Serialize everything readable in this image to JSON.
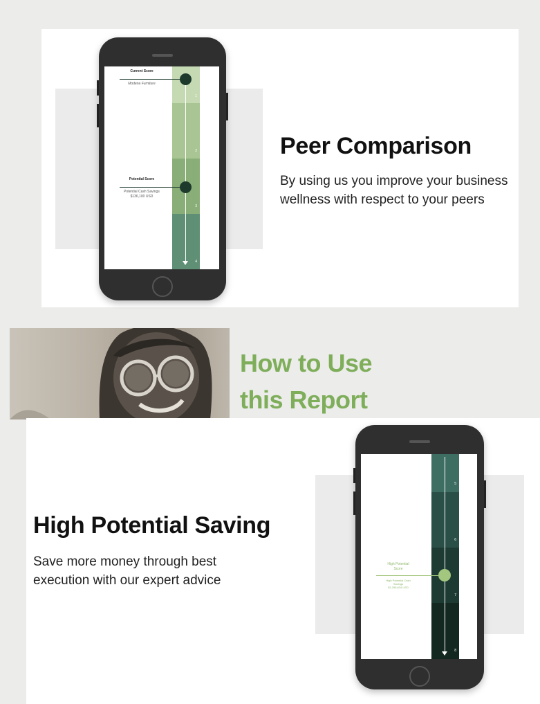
{
  "peer_section": {
    "heading": "Peer Comparison",
    "body": "By using us you improve your business wellness with respect to your peers",
    "phone": {
      "current_score_label": "Current Score",
      "current_score_sub": "Modena Furniture",
      "potential_score_label": "Potential Score",
      "potential_score_sub": "Potential Cash Savings",
      "potential_score_value": "$136,100 USD",
      "band_numbers": [
        "1",
        "2",
        "3",
        "4"
      ],
      "band_colors": [
        "#c5d9b3",
        "#a9c593",
        "#8aae78",
        "#5f8f75"
      ],
      "marker_color": "#1d3a2c"
    }
  },
  "how_to_section": {
    "title_line1": "How to Use",
    "title_line2": "this Report",
    "title_color": "#7fae5b"
  },
  "saving_section": {
    "heading": "High Potential Saving",
    "body": "Save more money through best execution with our expert advice",
    "phone": {
      "score_label_line1": "High Potential",
      "score_label_line2": "Score",
      "sub_line1": "High Potential Cash",
      "sub_line2": "Savings",
      "value": "$1,295,834 USD",
      "band_numbers": [
        "5",
        "6",
        "7",
        "8"
      ],
      "band_colors": [
        "#3e6d62",
        "#2a4f47",
        "#1e3b33",
        "#142822"
      ],
      "marker_color": "#a3c77f"
    }
  }
}
